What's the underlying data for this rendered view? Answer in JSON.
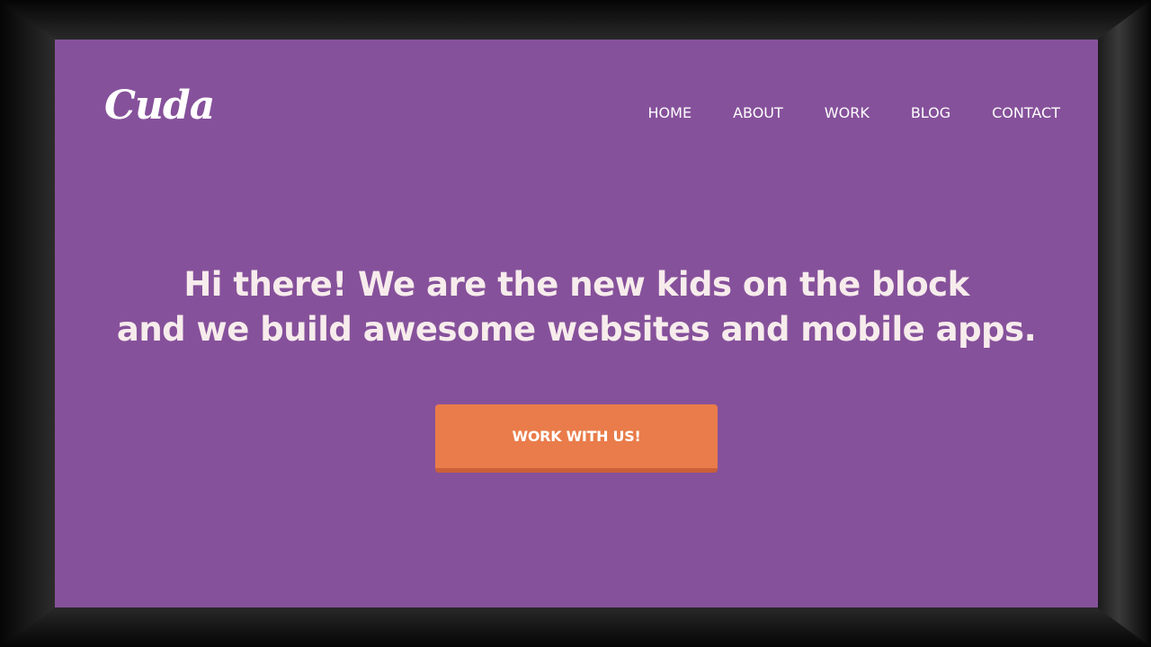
{
  "colors": {
    "background": "#86519B",
    "button": "#E97C4A",
    "button_shadow": "#C9603A",
    "text": "#FFFFFF"
  },
  "header": {
    "logo": "Cuda",
    "nav": [
      "HOME",
      "ABOUT",
      "WORK",
      "BLOG",
      "CONTACT"
    ]
  },
  "hero": {
    "line1": "Hi there! We are the new kids on the block",
    "line2": "and we build awesome websites and mobile apps.",
    "cta_label": "WORK WITH US!"
  }
}
